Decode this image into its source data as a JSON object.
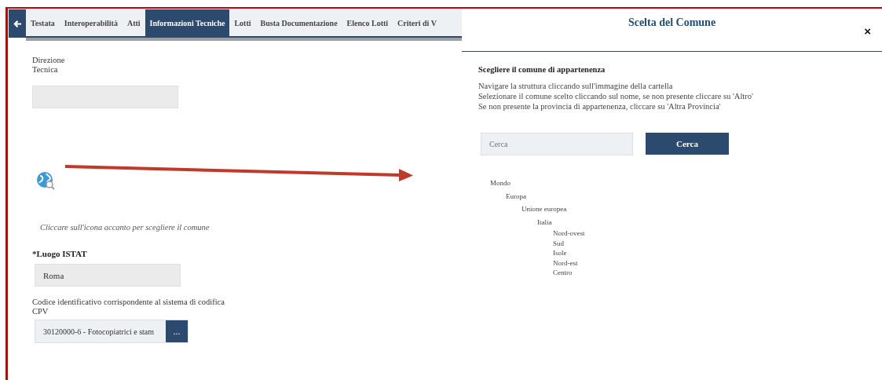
{
  "tabs": [
    {
      "label": "Testata",
      "selected": false
    },
    {
      "label": "Interoperabilità",
      "selected": false
    },
    {
      "label": "Atti",
      "selected": false
    },
    {
      "label": "Informazioni Tecniche",
      "selected": true
    },
    {
      "label": "Lotti",
      "selected": false
    },
    {
      "label": "Busta Documentazione",
      "selected": false
    },
    {
      "label": "Elenco Lotti",
      "selected": false
    },
    {
      "label": "Criteri di V",
      "selected": false
    }
  ],
  "form": {
    "direzione_label": "Direzione\nTecnica",
    "hint": "Cliccare sull'icona accanto per scegliere il comune",
    "luogo_label": "*Luogo ISTAT",
    "luogo_value": "Roma",
    "cpv_label": "Codice identificativo corrispondente al sistema di codifica\nCPV",
    "cpv_value": "30120000-6 - Fotocopiatrici e stam",
    "cpv_button": "..."
  },
  "dialog": {
    "title": "Scelta del Comune",
    "close": "×",
    "heading": "Scegliere il comune di appartenenza",
    "instructions": [
      "Navigare la struttura cliccando sull'immagine della cartella",
      "Selezionare il comune scelto cliccando sul nome, se non presente cliccare su 'Altro'",
      "Se non presente la provincia di appartenenza, cliccare su 'Altra Provincia'"
    ],
    "search": {
      "placeholder": "Cerca",
      "button": "Cerca"
    },
    "tree": [
      {
        "label": "Mondo",
        "children": [
          {
            "label": "Europa",
            "children": [
              {
                "label": "Unione europea",
                "children": [
                  {
                    "label": "Italia",
                    "children": [
                      {
                        "label": "Nord-ovest"
                      },
                      {
                        "label": "Sud"
                      },
                      {
                        "label": "Isole"
                      },
                      {
                        "label": "Nord-est"
                      },
                      {
                        "label": "Centro"
                      }
                    ]
                  }
                ]
              }
            ]
          }
        ]
      }
    ]
  }
}
